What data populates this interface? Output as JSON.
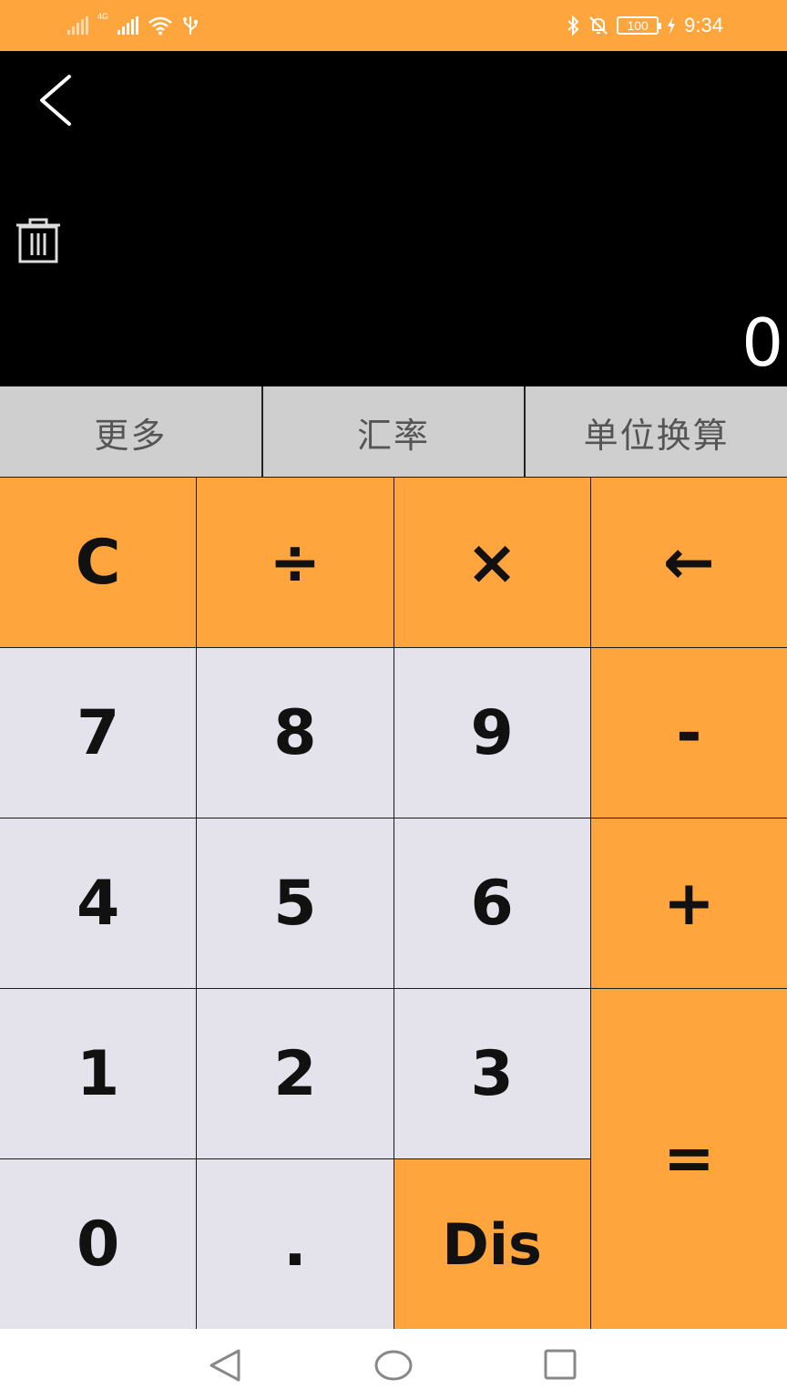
{
  "status_bar": {
    "network_label": "4G",
    "battery_level": "100",
    "time": "9:34",
    "background": "#FFA53E",
    "icons": [
      "signal-icon",
      "signal-4g-icon",
      "wifi-icon",
      "usb-icon",
      "bluetooth-icon",
      "mute-bell-icon",
      "battery-icon",
      "charging-icon"
    ]
  },
  "display": {
    "value": "0",
    "back_icon": "chevron-left-icon",
    "clear_history_icon": "trash-icon"
  },
  "tabs": [
    {
      "label": "更多"
    },
    {
      "label": "汇率"
    },
    {
      "label": "单位换算"
    }
  ],
  "keys": {
    "clear": "C",
    "divide": "÷",
    "multiply": "×",
    "backspace": "←",
    "seven": "7",
    "eight": "8",
    "nine": "9",
    "minus": "-",
    "four": "4",
    "five": "5",
    "six": "6",
    "plus": "+",
    "one": "1",
    "two": "2",
    "three": "3",
    "equals": "=",
    "zero": "0",
    "decimal": ".",
    "dis": "Dis"
  },
  "colors": {
    "accent": "#FFA53E",
    "number_key": "#E4E3EC",
    "tab_bg": "#CFCFCF",
    "display_bg": "#000000"
  },
  "nav_bar": {
    "icons": [
      "nav-back-icon",
      "nav-home-icon",
      "nav-recents-icon"
    ]
  }
}
